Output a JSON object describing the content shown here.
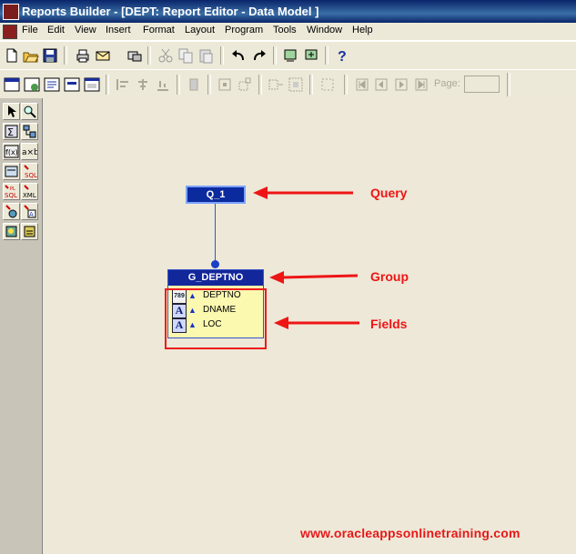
{
  "window": {
    "title": "Reports Builder - [DEPT: Report Editor - Data Model ]"
  },
  "menu": [
    "File",
    "Edit",
    "View",
    "Insert",
    "Format",
    "Layout",
    "Program",
    "Tools",
    "Window",
    "Help"
  ],
  "toolbar2": {
    "page_label": "Page:"
  },
  "palette_tools": [
    "select-tool",
    "magnify-tool",
    "summary-column-tool",
    "data-link-tool",
    "formula-column-tool",
    "placeholder-column-tool",
    "query-tool",
    "sql-query-tool",
    "plsql-query-tool",
    "xml-query-tool",
    "ref-cursor-tool",
    "text-query-tool",
    "express-query-tool",
    "ole-query-tool"
  ],
  "data_model": {
    "query": {
      "name": "Q_1"
    },
    "group": {
      "name": "G_DEPTNO",
      "fields": [
        {
          "name": "DEPTNO",
          "type_badge": "789"
        },
        {
          "name": "DNAME",
          "type_badge": "A"
        },
        {
          "name": "LOC",
          "type_badge": "A"
        }
      ]
    }
  },
  "annotations": {
    "query_label": "Query",
    "group_label": "Group",
    "fields_label": "Fields",
    "website": "www.oracleappsonlinetraining.com"
  },
  "colors": {
    "annotation": "#ee1515",
    "query_fill": "#0b2a9e",
    "group_header": "#12279a",
    "group_body": "#fbf8b0"
  }
}
